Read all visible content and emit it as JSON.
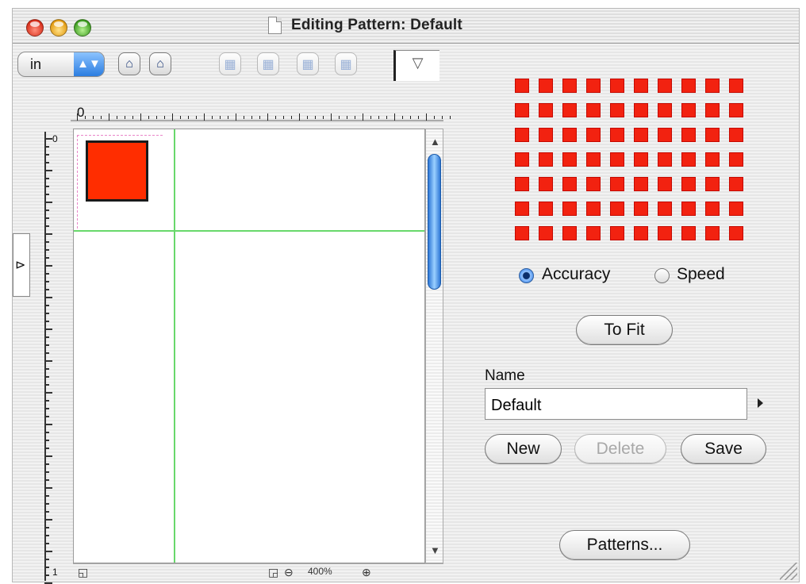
{
  "window": {
    "title": "Editing Pattern: Default"
  },
  "toolbar": {
    "unit": "in",
    "unit_arrows": "▲▼",
    "lock_icon": "⌂",
    "unlock_icon": "⌂",
    "tool_icons": [
      "▦",
      "▦",
      "▦",
      "▦"
    ],
    "triangle": "▽"
  },
  "rulers": {
    "horizontal_zero": "0",
    "vertical_numbers": [
      "0",
      "1"
    ]
  },
  "canvas": {
    "zoom": "400%"
  },
  "preview": {
    "rows": 7,
    "columns": 10
  },
  "options": {
    "accuracy_label": "Accuracy",
    "speed_label": "Speed",
    "selected": "Accuracy"
  },
  "buttons": {
    "to_fit": "To Fit",
    "new": "New",
    "delete": "Delete",
    "save": "Save",
    "patterns": "Patterns..."
  },
  "name": {
    "label": "Name",
    "value": "Default"
  },
  "colors": {
    "accent_blue": "#2b7de0",
    "pattern_red": "#f22210",
    "guide_green": "#68d86b",
    "tile_outline_pink": "#e986c9"
  },
  "icons": {
    "close": "close-icon",
    "minimize": "minimize-icon",
    "zoom": "zoom-icon",
    "document": "document-icon",
    "scroll_up": "▲",
    "scroll_down": "▼",
    "zoom_out": "⊖",
    "zoom_in": "⊕",
    "page_icon": "◱",
    "fit_icon": "◲"
  }
}
